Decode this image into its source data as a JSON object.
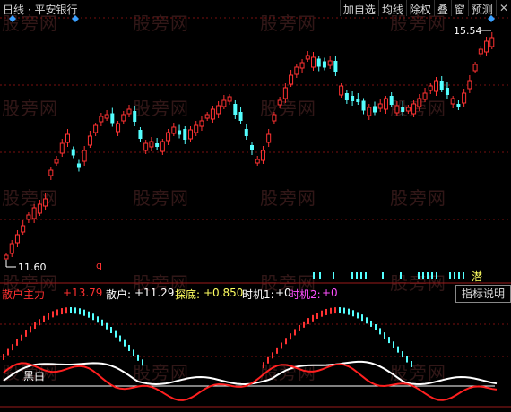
{
  "header": {
    "title": "日线 · 平安银行",
    "toolbar": [
      "加自选",
      "均线",
      "除权",
      "叠",
      "窗",
      "预测"
    ],
    "close_glyph": "✕"
  },
  "main_chart": {
    "high_label": "15.54",
    "low_label": "11.60",
    "marker_q": "q",
    "marker_tian": "潜"
  },
  "indicator": {
    "name": "散户主力",
    "main_force_value": "+13.79",
    "retail_label": "散户:",
    "retail_value": "+11.29",
    "bottom_label": "探底:",
    "bottom_value": "+0.850",
    "timing1_label": "时机1:",
    "timing1_value": "+0",
    "timing2_label": "时机2:",
    "timing2_value": "+0",
    "explain_button": "指标说明",
    "panel_label": "黑白"
  },
  "watermark": "股旁网",
  "colors": {
    "up": "#ff3232",
    "down": "#54ffff",
    "main_force": "#ff2020",
    "retail": "#ffffff",
    "bottom": "#ffff60",
    "timing2": "#ff50ff"
  }
}
